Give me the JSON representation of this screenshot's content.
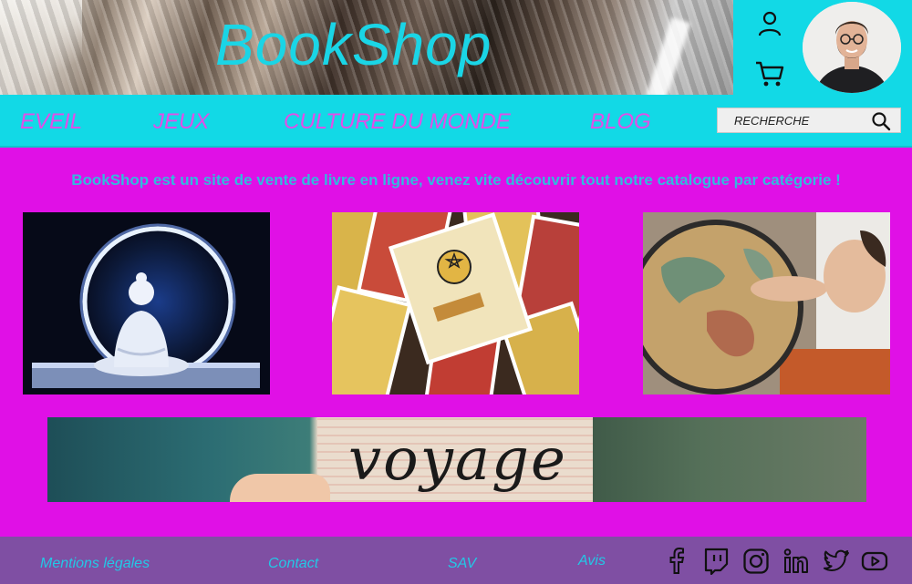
{
  "header": {
    "brand": "BookShop",
    "account_icon": "user-icon",
    "cart_icon": "cart-icon",
    "avatar": "profile-avatar"
  },
  "nav": {
    "items": [
      {
        "label": "EVEIL"
      },
      {
        "label": "JEUX"
      },
      {
        "label": "CULTURE DU MONDE"
      },
      {
        "label": "BLOG"
      }
    ],
    "search_placeholder": "RECHERCHE",
    "search_icon": "search-icon"
  },
  "main": {
    "tagline": "BookShop est un site de vente de livre en ligne, venez vite découvrir tout notre catalogue par catégorie !",
    "categories": [
      "buddha-image",
      "tarot-cards-image",
      "globe-image"
    ],
    "banner_word": "voyage"
  },
  "footer": {
    "links": [
      {
        "label": "Mentions légales"
      },
      {
        "label": "Contact"
      },
      {
        "label": "SAV"
      },
      {
        "label": "Avis"
      }
    ],
    "social": [
      "facebook-icon",
      "twitch-icon",
      "instagram-icon",
      "linkedin-icon",
      "twitter-icon",
      "youtube-icon"
    ]
  },
  "colors": {
    "cyan": "#12d9e6",
    "magenta": "#e010e6",
    "footer_purple": "#7f4fa3",
    "nav_text": "#e24ee7",
    "tagline_text": "#33b9dd"
  }
}
